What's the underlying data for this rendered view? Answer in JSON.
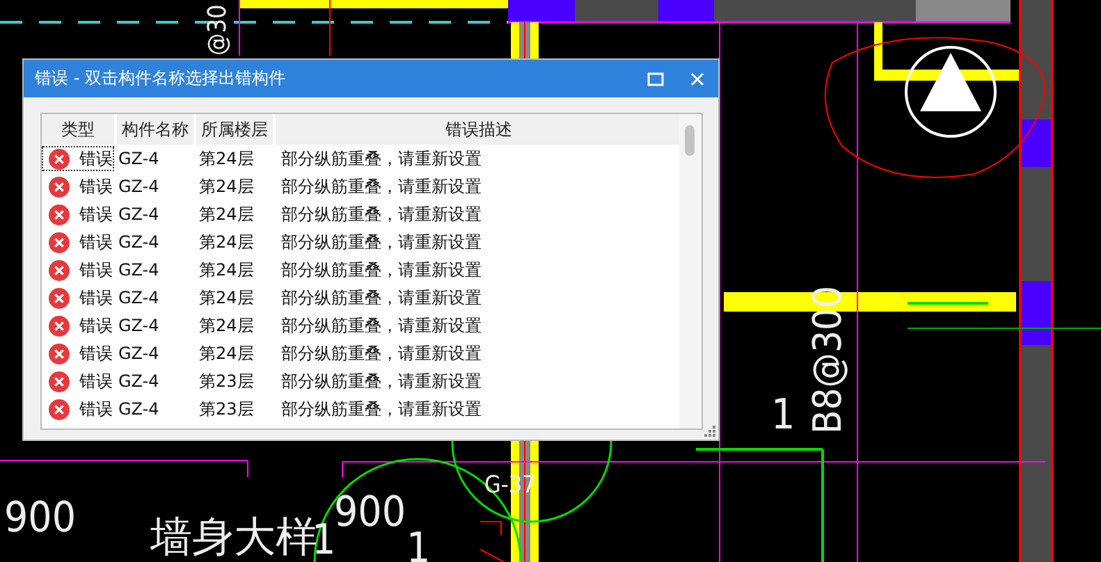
{
  "cad_labels": [
    {
      "text": "@30"
    },
    {
      "text": "900"
    },
    {
      "text": "墙身大样"
    },
    {
      "text": "1"
    },
    {
      "text": "900"
    },
    {
      "text": "1"
    },
    {
      "text": "G-37"
    },
    {
      "text": "1"
    },
    {
      "text": "B8@300"
    }
  ],
  "dialog": {
    "title": "错误 - 双击构件名称选择出错构件",
    "columns": [
      "类型",
      "构件名称",
      "所属楼层",
      "错误描述"
    ],
    "rows": [
      {
        "type": "错误",
        "name": "GZ-4",
        "floor": "第24层",
        "description": "部分纵筋重叠，请重新设置",
        "focused": true
      },
      {
        "type": "错误",
        "name": "GZ-4",
        "floor": "第24层",
        "description": "部分纵筋重叠，请重新设置",
        "focused": false
      },
      {
        "type": "错误",
        "name": "GZ-4",
        "floor": "第24层",
        "description": "部分纵筋重叠，请重新设置",
        "focused": false
      },
      {
        "type": "错误",
        "name": "GZ-4",
        "floor": "第24层",
        "description": "部分纵筋重叠，请重新设置",
        "focused": false
      },
      {
        "type": "错误",
        "name": "GZ-4",
        "floor": "第24层",
        "description": "部分纵筋重叠，请重新设置",
        "focused": false
      },
      {
        "type": "错误",
        "name": "GZ-4",
        "floor": "第24层",
        "description": "部分纵筋重叠，请重新设置",
        "focused": false
      },
      {
        "type": "错误",
        "name": "GZ-4",
        "floor": "第24层",
        "description": "部分纵筋重叠，请重新设置",
        "focused": false
      },
      {
        "type": "错误",
        "name": "GZ-4",
        "floor": "第24层",
        "description": "部分纵筋重叠，请重新设置",
        "focused": false
      },
      {
        "type": "错误",
        "name": "GZ-4",
        "floor": "第23层",
        "description": "部分纵筋重叠，请重新设置",
        "focused": false
      },
      {
        "type": "错误",
        "name": "GZ-4",
        "floor": "第23层",
        "description": "部分纵筋重叠，请重新设置",
        "focused": false
      }
    ]
  }
}
